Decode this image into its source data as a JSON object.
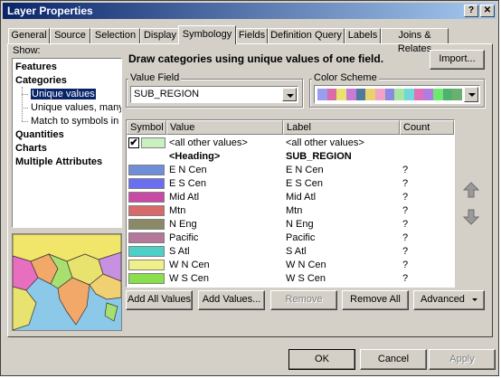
{
  "window": {
    "title": "Layer Properties",
    "help_glyph": "?",
    "close_glyph": "✕"
  },
  "tabs": [
    {
      "label": "General"
    },
    {
      "label": "Source"
    },
    {
      "label": "Selection"
    },
    {
      "label": "Display"
    },
    {
      "label": "Symbology",
      "active": true
    },
    {
      "label": "Fields"
    },
    {
      "label": "Definition Query"
    },
    {
      "label": "Labels"
    },
    {
      "label": "Joins & Relates"
    }
  ],
  "show": {
    "label": "Show:",
    "features": "Features",
    "categories": "Categories",
    "unique_values": "Unique values",
    "unique_values_many": "Unique values, many f",
    "match_symbols": "Match to symbols in a",
    "quantities": "Quantities",
    "charts": "Charts",
    "multiple_attributes": "Multiple Attributes"
  },
  "description": "Draw categories using unique values of one field.",
  "import_button": "Import...",
  "value_field": {
    "group_label": "Value Field",
    "selected": "SUB_REGION"
  },
  "color_scheme": {
    "group_label": "Color Scheme",
    "colors": [
      "#9a9cf0",
      "#d96da8",
      "#e8e26e",
      "#c97ad6",
      "#4e7a9e",
      "#e8d26e",
      "#f2a3c4",
      "#8a8ae0",
      "#a8e6a0",
      "#6fd8d8",
      "#e36fb4",
      "#b07ee0",
      "#6ee870",
      "#4fb070",
      "#6ab06f"
    ]
  },
  "table": {
    "headers": {
      "symbol": "Symbol",
      "value": "Value",
      "label": "Label",
      "count": "Count"
    },
    "all_other": {
      "value": "<all other values>",
      "label": "<all other values>",
      "color": "#c8f0c0",
      "checked": "✔"
    },
    "heading": {
      "value": "<Heading>",
      "label": "SUB_REGION"
    },
    "rows": [
      {
        "value": "E N Cen",
        "label": "E N Cen",
        "count": "?",
        "color": "#6e8ed8"
      },
      {
        "value": "E S Cen",
        "label": "E S Cen",
        "count": "?",
        "color": "#6a6ef0"
      },
      {
        "value": "Mid Atl",
        "label": "Mid Atl",
        "count": "?",
        "color": "#c84aa6"
      },
      {
        "value": "Mtn",
        "label": "Mtn",
        "count": "?",
        "color": "#d86a6a"
      },
      {
        "value": "N Eng",
        "label": "N Eng",
        "count": "?",
        "color": "#8a8a66"
      },
      {
        "value": "Pacific",
        "label": "Pacific",
        "count": "?",
        "color": "#b4789a"
      },
      {
        "value": "S Atl",
        "label": "S Atl",
        "count": "?",
        "color": "#4ed0c8"
      },
      {
        "value": "W N Cen",
        "label": "W N Cen",
        "count": "?",
        "color": "#f0f08a"
      },
      {
        "value": "W S Cen",
        "label": "W S Cen",
        "count": "?",
        "color": "#8ae04a"
      }
    ]
  },
  "buttons": {
    "add_all": "Add All Values",
    "add_values": "Add Values...",
    "remove": "Remove",
    "remove_all": "Remove All",
    "advanced": "Advanced",
    "ok": "OK",
    "cancel": "Cancel",
    "apply": "Apply"
  }
}
